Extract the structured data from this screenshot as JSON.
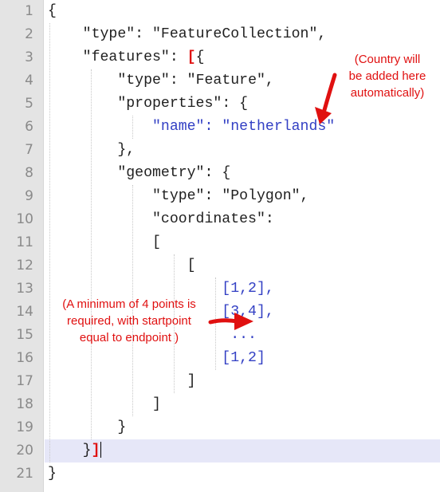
{
  "line_numbers": [
    "1",
    "2",
    "3",
    "4",
    "5",
    "6",
    "7",
    "8",
    "9",
    "10",
    "11",
    "12",
    "13",
    "14",
    "15",
    "16",
    "17",
    "18",
    "19",
    "20",
    "21"
  ],
  "code": {
    "l1": "{",
    "l2_key": "\"type\"",
    "l2_sep": ": ",
    "l2_val": "\"FeatureCollection\",",
    "l3_key": "\"features\"",
    "l3_sep": ": ",
    "l3_bracket": "[",
    "l3_brace": "{",
    "l4_key": "\"type\"",
    "l4_sep": ": ",
    "l4_val": "\"Feature\",",
    "l5_key": "\"properties\"",
    "l5_sep": ": {",
    "l6_key": "\"name\"",
    "l6_sep": ": ",
    "l6_val": "\"netherlands\"",
    "l7": "},",
    "l8_key": "\"geometry\"",
    "l8_sep": ": {",
    "l9_key": "\"type\"",
    "l9_sep": ": ",
    "l9_val": "\"Polygon\",",
    "l10_key": "\"coordinates\"",
    "l10_sep": ":",
    "l11": "[",
    "l12": "[",
    "l13": "[1,2],",
    "l14": "[3,4],",
    "l15": "...",
    "l16": "[1,2]",
    "l17": "]",
    "l18": "]",
    "l19": "}",
    "l20_brace": "}",
    "l20_bracket": "]",
    "l21": "}"
  },
  "annotations": {
    "country_line1": "(Country will",
    "country_line2": "be added here",
    "country_line3": "automatically)",
    "points_line1": "(A minimum of 4 points is",
    "points_line2": "required, with startpoint",
    "points_line3": "equal to endpoint )"
  },
  "colors": {
    "gutter": "#e4e4e4",
    "highlight_line": "#e6e7f8",
    "annotation": "#e01010",
    "blue_value": "#3340c4"
  }
}
